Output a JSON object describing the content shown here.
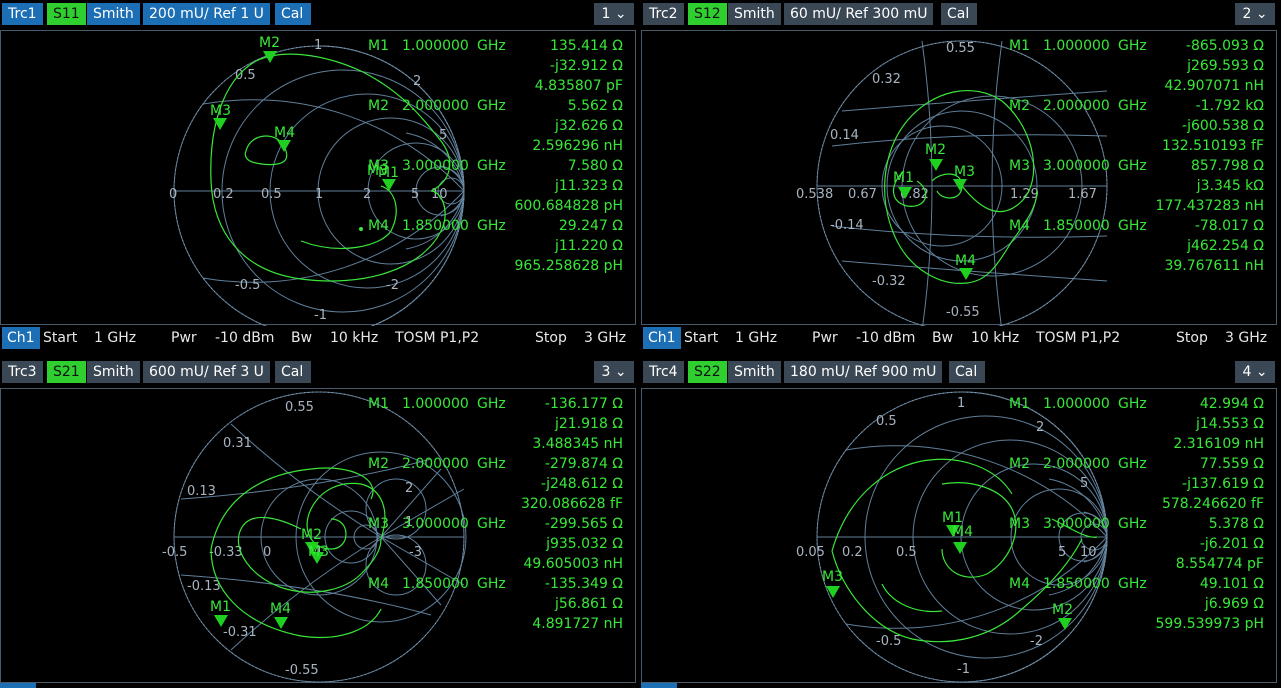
{
  "colors": {
    "trace": "#39e639",
    "grid": "#5f7f9a",
    "active_tab": "#1c6fb5",
    "inactive_tab": "#3a4754",
    "param": "#2fcf2f"
  },
  "panes": [
    {
      "trace": "Trc1",
      "param": "S11",
      "format": "Smith",
      "scale": "200 mU/ Ref 1 U",
      "cal": "Cal",
      "number": "1",
      "markers": [
        {
          "label": "M1",
          "freq": "1.000000",
          "unit": "GHz",
          "v1": "135.414 Ω",
          "v2": "-j32.912 Ω",
          "v3": "4.835807 pF"
        },
        {
          "label": "M2",
          "freq": "2.000000",
          "unit": "GHz",
          "v1": "5.562 Ω",
          "v2": "j32.626 Ω",
          "v3": "2.596296 nH"
        },
        {
          "label": "M3",
          "freq": "3.000000",
          "unit": "GHz",
          "v1": "7.580 Ω",
          "v2": "j11.323 Ω",
          "v3": "600.684828 pH"
        },
        {
          "label": "M4",
          "freq": "1.850000",
          "unit": "GHz",
          "v1": "29.247 Ω",
          "v2": "j11.220 Ω",
          "v3": "965.258628 pH"
        }
      ],
      "grid_labels": [
        "0.5",
        "1",
        "2",
        "0",
        "0.2",
        "0.5",
        "1",
        "2",
        "5",
        "10",
        "-0.5",
        "-1",
        "-2",
        "5"
      ],
      "chart_markers": [
        "M2",
        "M3",
        "M4",
        "M3",
        "M1"
      ]
    },
    {
      "trace": "Trc2",
      "param": "S12",
      "format": "Smith",
      "scale": "60 mU/ Ref 300 mU",
      "cal": "Cal",
      "number": "2",
      "markers": [
        {
          "label": "M1",
          "freq": "1.000000",
          "unit": "GHz",
          "v1": "-865.093 Ω",
          "v2": "j269.593 Ω",
          "v3": "42.907071 nH"
        },
        {
          "label": "M2",
          "freq": "2.000000",
          "unit": "GHz",
          "v1": "-1.792 kΩ",
          "v2": "-j600.538 Ω",
          "v3": "132.510193 fF"
        },
        {
          "label": "M3",
          "freq": "3.000000",
          "unit": "GHz",
          "v1": "857.798 Ω",
          "v2": "j3.345 kΩ",
          "v3": "177.437283 nH"
        },
        {
          "label": "M4",
          "freq": "1.850000",
          "unit": "GHz",
          "v1": "-78.017 Ω",
          "v2": "j462.254 Ω",
          "v3": "39.767611 nH"
        }
      ],
      "grid_labels": [
        "0.55",
        "0.32",
        "0.14",
        "0.538",
        "0.67",
        "0.82",
        "1.29",
        "1.67",
        "-0.14",
        "-0.32",
        "-0.55"
      ],
      "chart_markers": [
        "M2",
        "M1",
        "M3",
        "M4"
      ]
    },
    {
      "trace": "Trc3",
      "param": "S21",
      "format": "Smith",
      "scale": "600 mU/ Ref 3 U",
      "cal": "Cal",
      "number": "3",
      "markers": [
        {
          "label": "M1",
          "freq": "1.000000",
          "unit": "GHz",
          "v1": "-136.177 Ω",
          "v2": "j21.918 Ω",
          "v3": "3.488345 nH"
        },
        {
          "label": "M2",
          "freq": "2.000000",
          "unit": "GHz",
          "v1": "-279.874 Ω",
          "v2": "-j248.612 Ω",
          "v3": "320.086628 fF"
        },
        {
          "label": "M3",
          "freq": "3.000000",
          "unit": "GHz",
          "v1": "-299.565 Ω",
          "v2": "j935.032 Ω",
          "v3": "49.605003 nH"
        },
        {
          "label": "M4",
          "freq": "1.850000",
          "unit": "GHz",
          "v1": "-135.349 Ω",
          "v2": "j56.861 Ω",
          "v3": "4.891727 nH"
        }
      ],
      "grid_labels": [
        "0.55",
        "0.31",
        "0.13",
        "-0.5",
        "-0.33",
        "0",
        "1",
        "-0.13",
        "-0.31",
        "-0.55",
        "2",
        "1",
        "-3"
      ],
      "chart_markers": [
        "M2",
        "M3",
        "M1",
        "M4"
      ]
    },
    {
      "trace": "Trc4",
      "param": "S22",
      "format": "Smith",
      "scale": "180 mU/ Ref 900 mU",
      "cal": "Cal",
      "number": "4",
      "markers": [
        {
          "label": "M1",
          "freq": "1.000000",
          "unit": "GHz",
          "v1": "42.994 Ω",
          "v2": "j14.553 Ω",
          "v3": "2.316109 nH"
        },
        {
          "label": "M2",
          "freq": "2.000000",
          "unit": "GHz",
          "v1": "77.559 Ω",
          "v2": "-j137.619 Ω",
          "v3": "578.246620 fF"
        },
        {
          "label": "M3",
          "freq": "3.000000",
          "unit": "GHz",
          "v1": "5.378 Ω",
          "v2": "-j6.201 Ω",
          "v3": "8.554774 pF"
        },
        {
          "label": "M4",
          "freq": "1.850000",
          "unit": "GHz",
          "v1": "49.101 Ω",
          "v2": "j6.969 Ω",
          "v3": "599.539973 pH"
        }
      ],
      "grid_labels": [
        "1",
        "0.5",
        "2",
        "0.05",
        "0.2",
        "0.5",
        "5",
        "10",
        "-0.5",
        "-1",
        "-2",
        "5"
      ],
      "chart_markers": [
        "M1",
        "M4",
        "M3",
        "M2"
      ]
    }
  ],
  "channel_bar": {
    "channel": "Ch1",
    "start_label": "Start",
    "start": "1 GHz",
    "pwr_label": "Pwr",
    "pwr": "-10 dBm",
    "bw_label": "Bw",
    "bw": "10 kHz",
    "cal": "TOSM P1,P2",
    "stop_label": "Stop",
    "stop": "3 GHz"
  }
}
